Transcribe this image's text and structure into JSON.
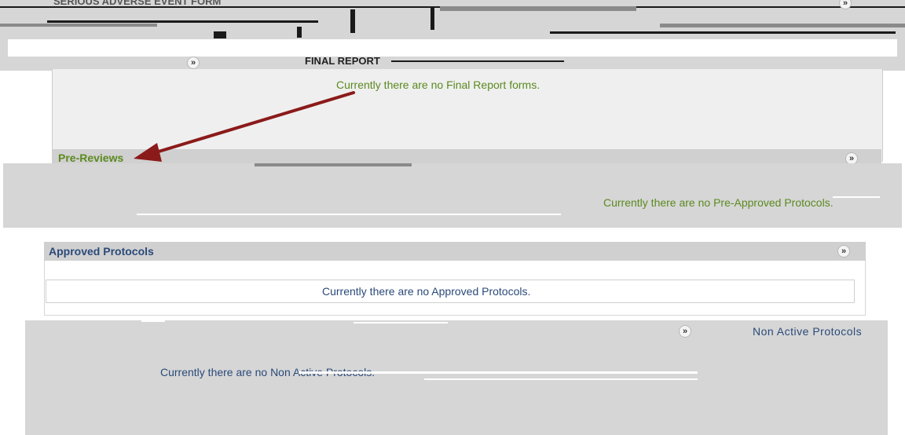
{
  "top_header": {
    "title": "SERIOUS ADVERSE EVENT FORM",
    "final_report_title": "FINAL REPORT"
  },
  "final_report": {
    "empty_message": "Currently there are no Final Report forms."
  },
  "pre_reviews": {
    "title": "Pre-Reviews",
    "empty_message": "Currently there are no Pre-Approved Protocols."
  },
  "approved_protocols": {
    "title": "Approved Protocols",
    "empty_message": "Currently there are no Approved Protocols."
  },
  "non_active_protocols": {
    "title": "Non Active Protocols",
    "empty_message": "Currently there are no Non Active Protocols."
  },
  "icons": {
    "toggle": "double-chevron-down-icon",
    "annotation": "red-arrow"
  },
  "colors": {
    "green_text": "#5b8a1f",
    "blue_text": "#2a4a7a",
    "arrow": "#8b1a1a"
  }
}
